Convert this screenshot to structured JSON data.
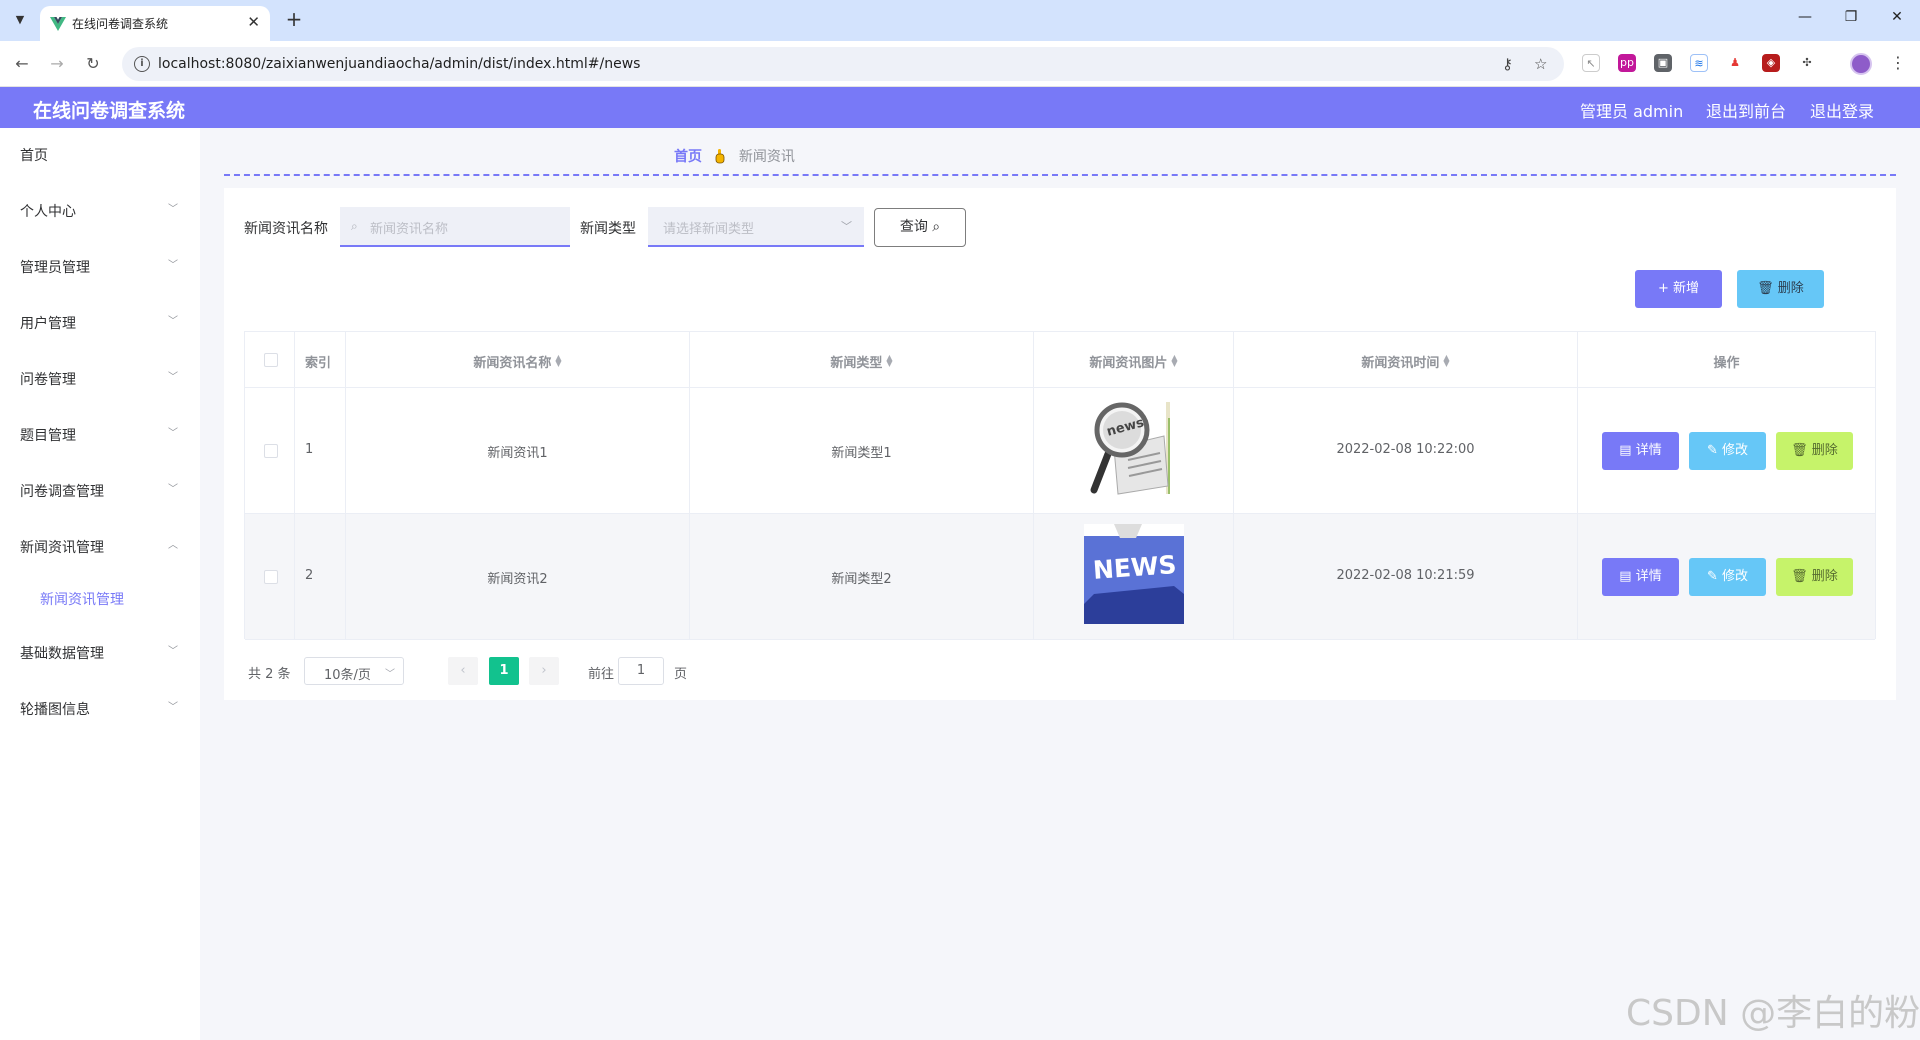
{
  "browser": {
    "tab_title": "在线问卷调查系统",
    "tab_close": "✕",
    "new_tab": "+",
    "url": "localhost:8080/zaixianwenjuandiaocha/admin/dist/index.html#/news",
    "window_controls": [
      "—",
      "❐",
      "✕"
    ]
  },
  "header": {
    "title": "在线问卷调查系统",
    "admin": "管理员 admin",
    "to_front": "退出到前台",
    "logout": "退出登录"
  },
  "sidebar": {
    "items": [
      {
        "label": "首页"
      },
      {
        "label": "个人中心"
      },
      {
        "label": "管理员管理"
      },
      {
        "label": "用户管理"
      },
      {
        "label": "问卷管理"
      },
      {
        "label": "题目管理"
      },
      {
        "label": "问卷调查管理"
      },
      {
        "label": "新闻资讯管理"
      },
      {
        "label": "基础数据管理"
      },
      {
        "label": "轮播图信息"
      }
    ],
    "sub_item": "新闻资讯管理"
  },
  "breadcrumb": {
    "home": "首页",
    "current": "新闻资讯"
  },
  "search": {
    "name_label": "新闻资讯名称",
    "name_placeholder": "新闻资讯名称",
    "type_label": "新闻类型",
    "type_placeholder": "请选择新闻类型",
    "query_button": "查询 ⌕"
  },
  "actions": {
    "add": "+ 新增",
    "delete": "🗑 删除"
  },
  "table": {
    "columns": {
      "index": "索引",
      "name": "新闻资讯名称",
      "type": "新闻类型",
      "image": "新闻资讯图片",
      "time": "新闻资讯时间",
      "ops": "操作"
    },
    "rows": [
      {
        "index": "1",
        "name": "新闻资讯1",
        "type": "新闻类型1",
        "image_icon": "magnifier-news-image",
        "time": "2022-02-08 10:22:00"
      },
      {
        "index": "2",
        "name": "新闻资讯2",
        "type": "新闻类型2",
        "image_icon": "news-key-image",
        "time": "2022-02-08 10:21:59"
      }
    ],
    "row_buttons": {
      "detail": "▤ 详情",
      "edit": "✎ 修改",
      "delete": "🗑 删除"
    },
    "thumb_text": {
      "magnifier": "news",
      "key": "NEWS"
    }
  },
  "pagination": {
    "total": "共 2 条",
    "page_size": "10条/页",
    "prev": "‹",
    "current_page": "1",
    "next": "›",
    "goto_prefix": "前往",
    "goto_value": "1",
    "goto_suffix": "页"
  },
  "watermark": "CSDN @李白的粉",
  "colors": {
    "accent": "#7879f7",
    "info": "#66c7f7",
    "warning": "#c6f36a",
    "page_active": "#12c28e"
  }
}
